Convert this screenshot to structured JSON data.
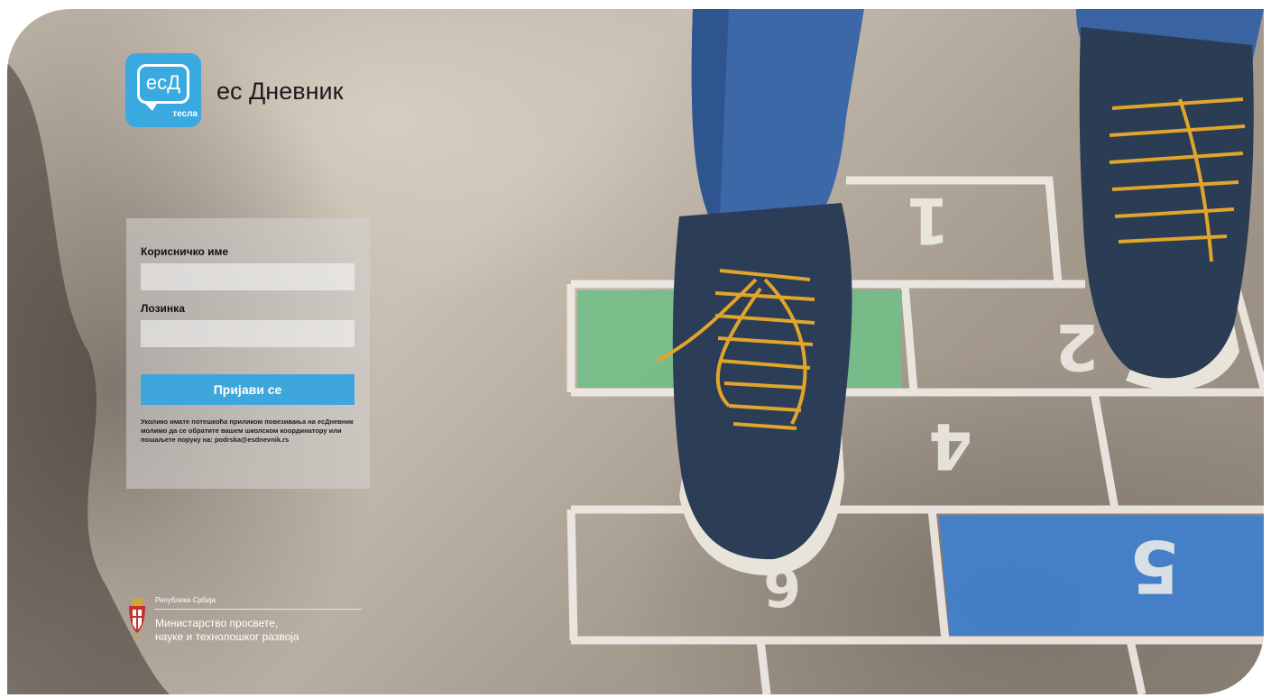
{
  "app": {
    "logo_mark": "есД",
    "logo_sub": "тесла",
    "name": "ес Дневник"
  },
  "login": {
    "username_label": "Корисничко име",
    "username_value": "",
    "password_label": "Лозинка",
    "password_value": "",
    "submit_label": "Пријави се",
    "help_text": "Уколико имате потешкоћа приликом повезивања на есДневник молимо да се обратите вашем школском координатору или пошаљете поруку на: podrska@esdnevnik.rs"
  },
  "footer": {
    "republic": "Република Србија",
    "ministry_line1": "Министарство просвете,",
    "ministry_line2": "науке и технолошког развоја"
  },
  "colors": {
    "brand_blue": "#3aa9e0",
    "button_blue": "#3fa6dc"
  },
  "icons": {
    "logo": "speech-bubble-logo",
    "coat_of_arms": "serbia-coat-of-arms-icon"
  }
}
